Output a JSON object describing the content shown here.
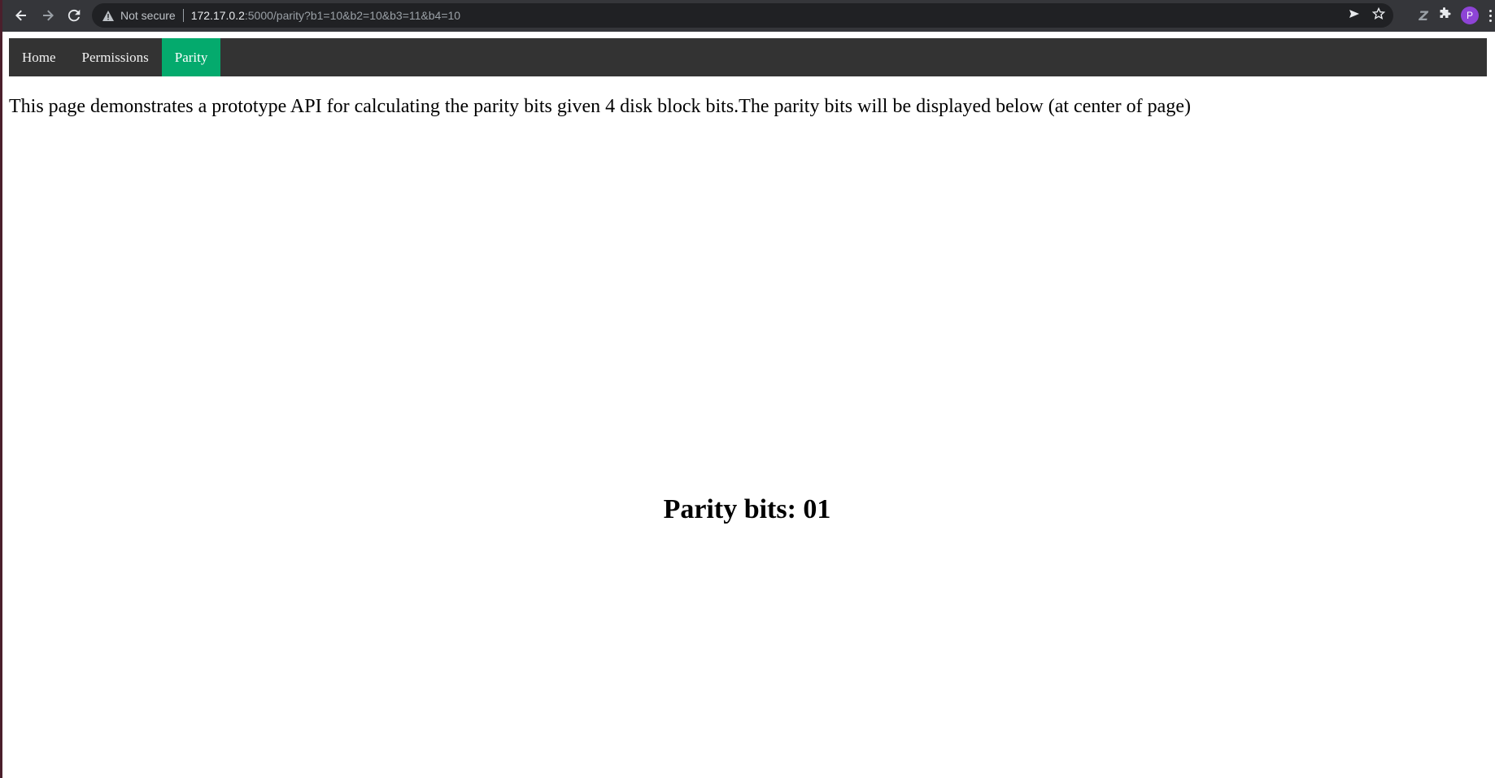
{
  "browser": {
    "security_label": "Not secure",
    "url_host": "172.17.0.2",
    "url_rest": ":5000/parity?b1=10&b2=10&b3=11&b4=10",
    "profile_initial": "P"
  },
  "nav": {
    "items": [
      {
        "label": "Home",
        "active": false
      },
      {
        "label": "Permissions",
        "active": false
      },
      {
        "label": "Parity",
        "active": true
      }
    ],
    "bg_color": "#333333",
    "active_color": "#04aa6d"
  },
  "intro_text": "This page demonstrates a prototype API for calculating the parity bits given 4 disk block bits.The parity bits will be displayed below (at center of page)",
  "result": {
    "label": "Parity bits:",
    "value": "01"
  }
}
